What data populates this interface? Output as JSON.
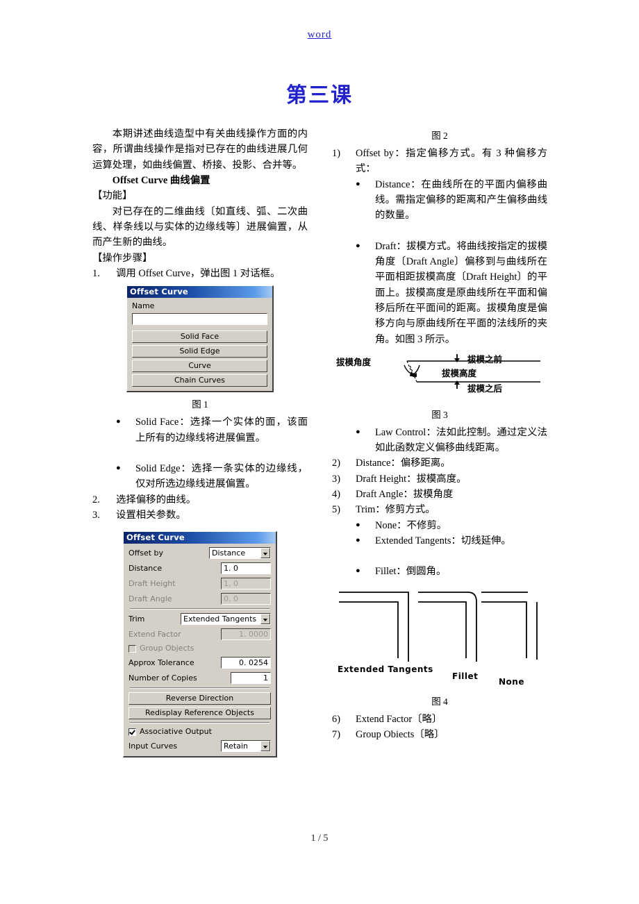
{
  "header": {
    "link_text": "word"
  },
  "title": "第三课",
  "footer": {
    "page_label": "1 / 5"
  },
  "left_column": {
    "intro_para": "本期讲述曲线造型中有关曲线操作方面的内容，所谓曲线操作是指对已存在的曲线进展几何运算处理，如曲线偏置、桥接、投影、合并等。",
    "section_heading": "Offset Curve 曲线偏置",
    "function_label": "【功能】",
    "function_para": "对已存在的二维曲线〔如直线、弧、二次曲线、样条线以与实体的边缘线等〕进展偏置，从而产生新的曲线。",
    "steps_label": "【操作步骤】",
    "step1_num": "1.",
    "step1_text": "调用 Offset Curve，弹出图 1 对话框。",
    "fig1_caption": "图 1",
    "bullet_glyph": "●",
    "solid_face_text": "Solid  Face：选择一个实体的面，该面上所有的边缘线将进展偏置。",
    "solid_edge_text": "Solid  Edge：选择一条实体的边缘线，仅对所选边缘线进展偏置。",
    "step2_num": "2.",
    "step2_text": "选择偏移的曲线。",
    "step3_num": "3.",
    "step3_text": "设置相关参数。"
  },
  "dialog1": {
    "title": "Offset Curve",
    "name_label": "Name",
    "name_value": "",
    "buttons": [
      "Solid Face",
      "Solid Edge",
      "Curve",
      "Chain Curves"
    ]
  },
  "dialog2": {
    "title": "Offset Curve",
    "rows": {
      "offset_by_label": "Offset by",
      "offset_by_value": "Distance",
      "distance_label": "Distance",
      "distance_value": "1. 0",
      "draft_height_label": "Draft Height",
      "draft_height_value": "1. 0",
      "draft_angle_label": "Draft Angle",
      "draft_angle_value": "0. 0",
      "trim_label": "Trim",
      "trim_value": "Extended Tangents",
      "extend_factor_label": "Extend Factor",
      "extend_factor_value": "1. 0000",
      "group_objects_label": "Group Objects",
      "approx_tolerance_label": "Approx Tolerance",
      "approx_tolerance_value": "0. 0254",
      "number_of_copies_label": "Number of Copies",
      "number_of_copies_value": "1",
      "reverse_direction_button": "Reverse Direction",
      "redisplay_button": "Redisplay Reference Objects",
      "associative_output_label": "Associative Output",
      "input_curves_label": "Input Curves",
      "input_curves_value": "Retain"
    }
  },
  "right_column": {
    "fig2_caption": "图 2",
    "bullet_glyph": "●",
    "item1_num": "1)",
    "item1_text": "Offset by：指定偏移方式。有 3 种偏移方式：",
    "distance_bullet": "Distance：在曲线所在的平面内偏移曲线。需指定偏移的距离和产生偏移曲线的数量。",
    "draft_bullet": "Draft：拔模方式。将曲线按指定的拔模角度〔Draft Angle〕偏移到与曲线所在平面相距拔模高度〔Draft Height〕的平面上。拔模高度是原曲线所在平面和偏移后所在平面间的距离。拔模角度是偏移方向与原曲线所在平面的法线所的夹角。如图 3 所示。",
    "fig3_caption": "图 3",
    "fig3_labels": {
      "draft_angle": "拔模角度",
      "before_draft": "拔模之前",
      "draft_height": "拔模高度",
      "after_draft": "拔模之后"
    },
    "law_control_bullet": "Law  Control：法如此控制。通过定义法如此函数定义偏移曲线距离。",
    "item2_num": "2)",
    "item2_text": "Distance：偏移距离。",
    "item3_num": "3)",
    "item3_text": "Draft Height：拔模高度。",
    "item4_num": "4)",
    "item4_text": "Draft Angle：拔模角度",
    "item5_num": "5)",
    "item5_text": "Trim：修剪方式。",
    "none_bullet": "None：不修剪。",
    "extended_tangents_bullet": "Extended Tangents：切线延伸。",
    "fillet_bullet": "Fillet：倒圆角。",
    "fig4_labels": {
      "extended_tangents": "Extended  Tangents",
      "fillet": "Fillet",
      "none": "None"
    },
    "fig4_caption": "图 4",
    "item6_num": "6)",
    "item6_text": "Extend Factor〔略〕",
    "item7_num": "7)",
    "item7_text": "Group Obiects〔略〕"
  }
}
